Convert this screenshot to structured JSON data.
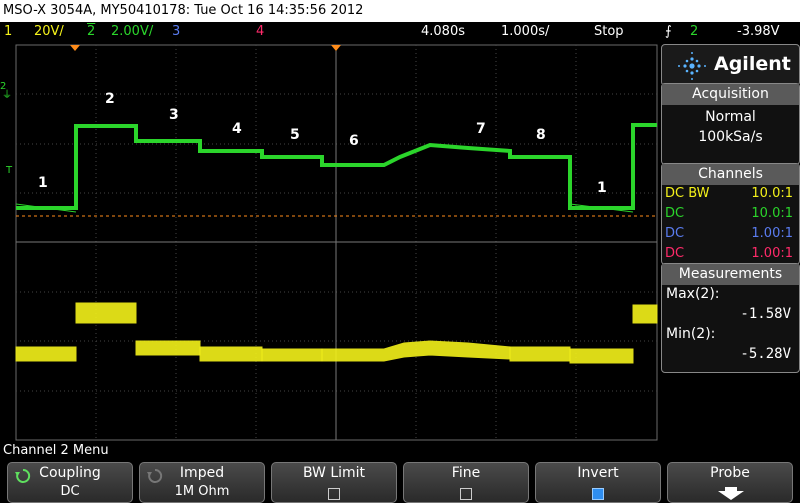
{
  "title": "MSO-X 3054A, MY50410178: Tue Oct 16 14:35:56 2012",
  "status": {
    "ch1_num": "1",
    "ch1_scale": "20V/",
    "ch2_num": "2",
    "ch2_scale": "2.00V/",
    "ch3_num": "3",
    "ch4_num": "4",
    "time_pos": "4.080s",
    "time_scale": "1.000s/",
    "run_state": "Stop",
    "trig_ch": "2",
    "trig_level": "-3.98V"
  },
  "brand": "Agilent",
  "acquisition": {
    "title": "Acquisition",
    "mode": "Normal",
    "rate": "100kSa/s"
  },
  "channels": {
    "title": "Channels",
    "rows": [
      {
        "coupling": "DC BW",
        "ratio": "10.0:1",
        "color": "#f4f21a"
      },
      {
        "coupling": "DC",
        "ratio": "10.0:1",
        "color": "#2bd52b"
      },
      {
        "coupling": "DC",
        "ratio": "1.00:1",
        "color": "#5a7cf0"
      },
      {
        "coupling": "DC",
        "ratio": "1.00:1",
        "color": "#ff2a6a"
      }
    ]
  },
  "measurements": {
    "title": "Measurements",
    "max_label": "Max(2):",
    "max_value": "-1.58V",
    "min_label": "Min(2):",
    "min_value": "-5.28V"
  },
  "menu_title": "Channel 2 Menu",
  "softkeys": [
    {
      "label": "Coupling",
      "value": "DC"
    },
    {
      "label": "Imped",
      "value": "1M Ohm"
    },
    {
      "label": "BW Limit",
      "value": ""
    },
    {
      "label": "Fine",
      "value": ""
    },
    {
      "label": "Invert",
      "value": ""
    },
    {
      "label": "Probe",
      "value": ""
    }
  ],
  "trace_labels": [
    "1",
    "2",
    "3",
    "4",
    "5",
    "6",
    "7",
    "8",
    "1"
  ],
  "colors": {
    "ch1": "#f4f21a",
    "ch2": "#2bd52b",
    "ch3": "#5a7cf0",
    "ch4": "#ff2a6a",
    "trigger_marker": "#ff8c1a"
  }
}
